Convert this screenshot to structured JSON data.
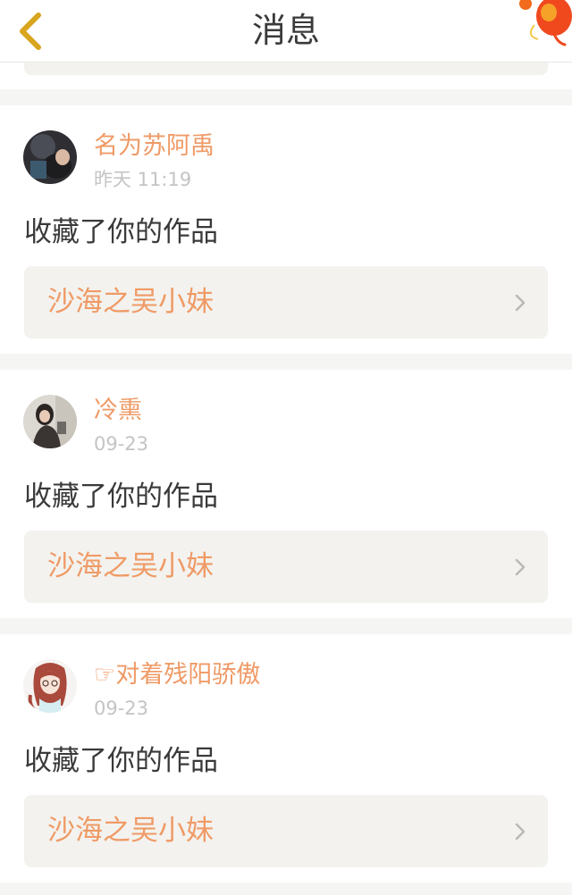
{
  "header": {
    "title": "消息",
    "back_icon": "chevron-left-icon",
    "decoration_icon": "lantern-icon",
    "accent": "#d8a51e"
  },
  "colors": {
    "accent_orange": "#ef9a66",
    "text_dark": "#3a3a3a",
    "text_muted": "#c4c4c4",
    "box_bg": "#f3f2ee"
  },
  "messages": [
    {
      "username": "名为苏阿禹",
      "time": "昨天 11:19",
      "action": "收藏了你的作品",
      "work_title": "沙海之吴小妹"
    },
    {
      "username": "冷熏",
      "time": "09-23",
      "action": "收藏了你的作品",
      "work_title": "沙海之吴小妹"
    },
    {
      "username": "☞对着残阳骄傲",
      "time": "09-23",
      "action": "收藏了你的作品",
      "work_title": "沙海之吴小妹"
    }
  ]
}
